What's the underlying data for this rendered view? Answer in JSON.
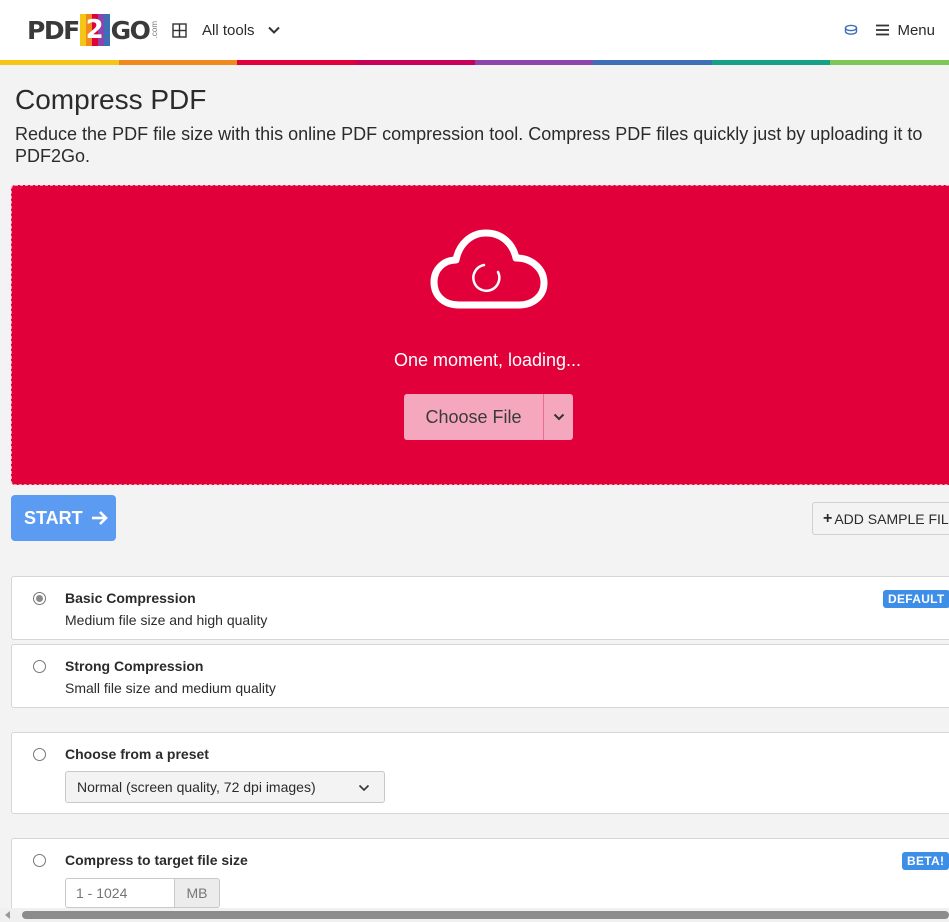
{
  "header": {
    "logo": {
      "pdf": "PDF",
      "two": "2",
      "go": "GO",
      "com": ".com"
    },
    "all_tools_label": "All tools",
    "menu_label": "Menu"
  },
  "colors": {
    "brand_red": "#e2003a",
    "start_blue": "#5b9cf2",
    "badge_blue": "#3d8ee6",
    "rainbow": [
      "#f5c518",
      "#f08a1c",
      "#e2003a",
      "#c8005a",
      "#8e44ad",
      "#3d6fb6",
      "#16a085",
      "#7dc855"
    ]
  },
  "page": {
    "title": "Compress PDF",
    "description": "Reduce the PDF file size with this online PDF compression tool. Compress PDF files quickly just by uploading it to PDF2Go."
  },
  "upload": {
    "status": "One moment, loading...",
    "choose_file_label": "Choose File"
  },
  "actions": {
    "start_label": "START",
    "add_sample_label": "ADD SAMPLE FILE"
  },
  "options": [
    {
      "title": "Basic Compression",
      "subtitle": "Medium file size and high quality",
      "badge": "DEFAULT",
      "checked": true
    },
    {
      "title": "Strong Compression",
      "subtitle": "Small file size and medium quality",
      "checked": false
    },
    {
      "title": "Choose from a preset",
      "select_value": "Normal (screen quality, 72 dpi images)",
      "checked": false
    },
    {
      "title": "Compress to target file size",
      "badge": "BETA!",
      "input_placeholder": "1 - 1024",
      "unit": "MB",
      "checked": false
    }
  ],
  "icons": {
    "grid": "grid-icon",
    "chevron": "chevron-down-icon",
    "coins": "coins-icon",
    "menu": "hamburger-icon",
    "cloud": "cloud-upload-icon",
    "arrow": "arrow-right-icon"
  }
}
